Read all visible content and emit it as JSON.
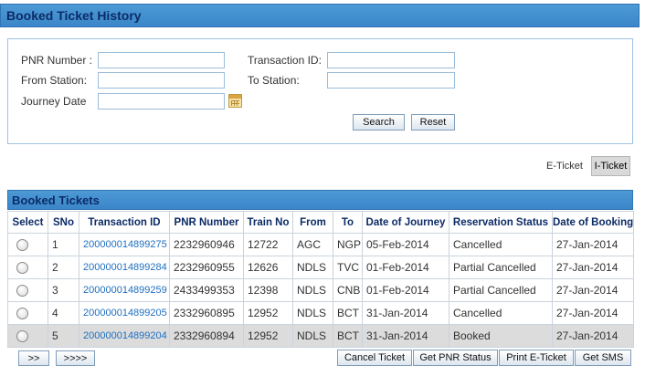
{
  "page": {
    "title": "Booked Ticket History"
  },
  "search": {
    "pnr_label": "PNR Number :",
    "pnr_value": "",
    "txn_label": "Transaction ID:",
    "txn_value": "",
    "from_label": "From Station:",
    "from_value": "",
    "to_label": "To Station:",
    "to_value": "",
    "date_label": "Journey Date",
    "date_value": "",
    "search_btn": "Search",
    "reset_btn": "Reset"
  },
  "tabs": {
    "eticket": "E-Ticket",
    "iticket": "I-Ticket",
    "active": "I-Ticket"
  },
  "grid": {
    "title": "Booked Tickets",
    "columns": [
      "Select",
      "SNo",
      "Transaction ID",
      "PNR Number",
      "Train No",
      "From",
      "To",
      "Date of Journey",
      "Reservation Status",
      "Date of Booking"
    ],
    "rows": [
      {
        "sno": "1",
        "txn": "200000014899275",
        "pnr": "2232960946",
        "train": "12722",
        "from": "AGC",
        "to": "NGP",
        "doj": "05-Feb-2014",
        "status": "Cancelled",
        "dob": "27-Jan-2014",
        "selected": false
      },
      {
        "sno": "2",
        "txn": "200000014899284",
        "pnr": "2232960955",
        "train": "12626",
        "from": "NDLS",
        "to": "TVC",
        "doj": "01-Feb-2014",
        "status": "Partial Cancelled",
        "dob": "27-Jan-2014",
        "selected": false
      },
      {
        "sno": "3",
        "txn": "200000014899259",
        "pnr": "2433499353",
        "train": "12398",
        "from": "NDLS",
        "to": "CNB",
        "doj": "01-Feb-2014",
        "status": "Partial Cancelled",
        "dob": "27-Jan-2014",
        "selected": false
      },
      {
        "sno": "4",
        "txn": "200000014899205",
        "pnr": "2332960895",
        "train": "12952",
        "from": "NDLS",
        "to": "BCT",
        "doj": "31-Jan-2014",
        "status": "Cancelled",
        "dob": "27-Jan-2014",
        "selected": false
      },
      {
        "sno": "5",
        "txn": "200000014899204",
        "pnr": "2332960894",
        "train": "12952",
        "from": "NDLS",
        "to": "BCT",
        "doj": "31-Jan-2014",
        "status": "Booked",
        "dob": "27-Jan-2014",
        "selected": true
      }
    ]
  },
  "pager": {
    "next": ">>",
    "last": ">>>>"
  },
  "actions": {
    "cancel": "Cancel Ticket",
    "pnr_status": "Get PNR Status",
    "print": "Print E-Ticket",
    "sms": "Get SMS"
  },
  "colors": {
    "header_bg": "#3a86c8",
    "header_text": "#0b2b66",
    "link": "#1f6fbf",
    "selected_row": "#dcdcdc"
  }
}
